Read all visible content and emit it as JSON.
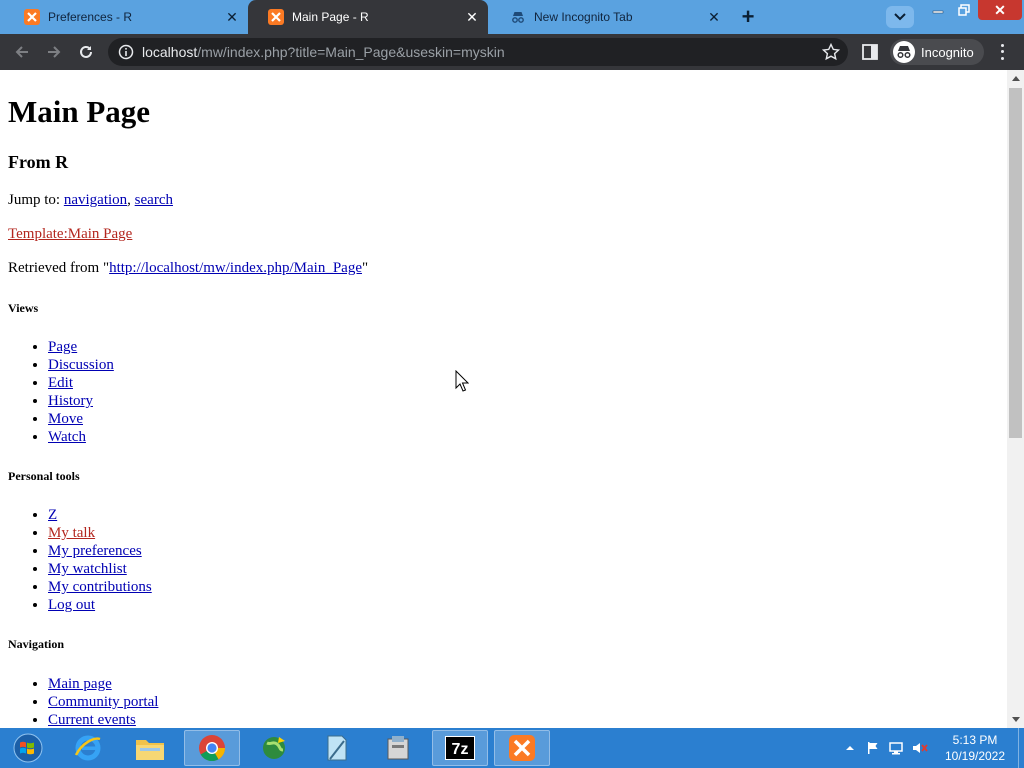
{
  "browser": {
    "tabs": [
      {
        "title": "Preferences - R",
        "favicon": "xampp-icon"
      },
      {
        "title": "Main Page - R",
        "favicon": "xampp-icon",
        "active": true
      },
      {
        "title": "New Incognito Tab",
        "favicon": "incognito-icon"
      }
    ],
    "url_host": "localhost",
    "url_path": "/mw/index.php?title=Main_Page&useskin=myskin",
    "profile_label": "Incognito"
  },
  "page": {
    "heading": "Main Page",
    "subheading": "From R",
    "jump_to_label": "Jump to: ",
    "jump_nav": "navigation",
    "jump_sep": ", ",
    "jump_search": "search",
    "template_link": "Template:Main Page",
    "retrieved_prefix": "Retrieved from \"",
    "retrieved_url": "http://localhost/mw/index.php/Main_Page",
    "retrieved_suffix": "\"",
    "views": {
      "title": "Views",
      "items": [
        "Page",
        "Discussion",
        "Edit",
        "History",
        "Move",
        "Watch"
      ]
    },
    "personal": {
      "title": "Personal tools",
      "items": [
        "Z",
        "My talk",
        "My preferences",
        "My watchlist",
        "My contributions",
        "Log out"
      ]
    },
    "navigation": {
      "title": "Navigation",
      "items": [
        "Main page",
        "Community portal",
        "Current events"
      ]
    }
  },
  "taskbar": {
    "apps": [
      "internet-explorer",
      "file-explorer",
      "chrome",
      "network-app",
      "notepad-app",
      "archive-app",
      "7zip",
      "xampp"
    ],
    "time": "5:13 PM",
    "date": "10/19/2022"
  },
  "colors": {
    "tabstrip": "#5aa2e0",
    "toolbar": "#35363a",
    "link": "#0000b3",
    "redlink": "#b3261e",
    "taskbar": "#2b7fd0"
  }
}
